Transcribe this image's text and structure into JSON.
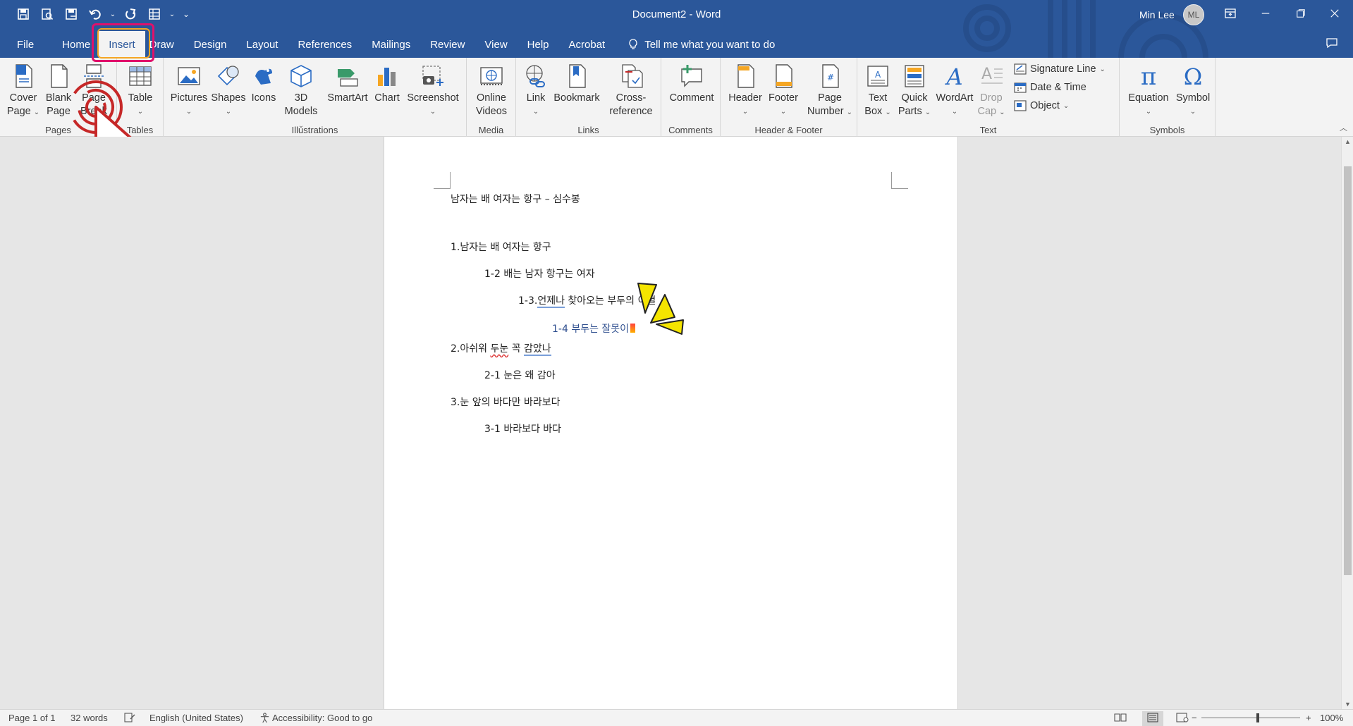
{
  "window": {
    "title": "Document2  -  Word",
    "user_name": "Min Lee",
    "user_initials": "ML"
  },
  "quick_access": [
    "save-icon",
    "print-preview-icon",
    "save-as-icon",
    "undo-icon",
    "redo-icon",
    "table-icon",
    "customize-icon"
  ],
  "tabs": [
    {
      "label": "File"
    },
    {
      "label": "Home"
    },
    {
      "label": "Insert",
      "active": true
    },
    {
      "label": "Draw"
    },
    {
      "label": "Design"
    },
    {
      "label": "Layout"
    },
    {
      "label": "References"
    },
    {
      "label": "Mailings"
    },
    {
      "label": "Review"
    },
    {
      "label": "View"
    },
    {
      "label": "Help"
    },
    {
      "label": "Acrobat"
    }
  ],
  "tell_me": "Tell me what you want to do",
  "ribbon": {
    "pages": {
      "label": "Pages",
      "cover_page": "Cover",
      "cover_page2": "Page",
      "blank_page": "Blank",
      "blank_page2": "Page",
      "page_break": "Page",
      "page_break2": "Break"
    },
    "tables": {
      "label": "Tables",
      "table": "Table"
    },
    "illustrations": {
      "label": "Illustrations",
      "pictures": "Pictures",
      "shapes": "Shapes",
      "icons": "Icons",
      "models": "3D",
      "models2": "Models",
      "smartart": "SmartArt",
      "chart": "Chart",
      "screenshot": "Screenshot"
    },
    "media": {
      "label": "Media",
      "online_videos": "Online",
      "online_videos2": "Videos"
    },
    "links": {
      "label": "Links",
      "link": "Link",
      "bookmark": "Bookmark",
      "cross_reference": "Cross-",
      "cross_reference2": "reference"
    },
    "comments": {
      "label": "Comments",
      "comment": "Comment"
    },
    "header_footer": {
      "label": "Header & Footer",
      "header": "Header",
      "footer": "Footer",
      "page_number": "Page",
      "page_number2": "Number"
    },
    "text": {
      "label": "Text",
      "text_box": "Text",
      "text_box2": "Box",
      "quick_parts": "Quick",
      "quick_parts2": "Parts",
      "wordart": "WordArt",
      "drop_cap": "Drop",
      "drop_cap2": "Cap",
      "signature_line": "Signature Line",
      "date_time": "Date & Time",
      "object": "Object"
    },
    "symbols": {
      "label": "Symbols",
      "equation": "Equation",
      "symbol": "Symbol"
    }
  },
  "document": {
    "lines": [
      "남자는 배 여자는 항구 – 심수봉",
      "1.남자는 배 여자는 항구",
      "1-2 배는 남자 항구는 여자",
      "1-3.",
      "언제나",
      " 찾아오는 부두의 이별",
      "1-4 부두는 잘못이",
      "2.아쉬워 ",
      "두눈",
      " 꼭 ",
      "감았나",
      "2-1 눈은 왜 감아",
      "3.눈 앞의 바다만 바라보다",
      "3-1 바라보다 바다"
    ]
  },
  "statusbar": {
    "page": "Page 1 of 1",
    "words": "32 words",
    "language": "English (United States)",
    "accessibility": "Accessibility: Good to go",
    "zoom_percent": "100%",
    "zoom_level": 1.0
  },
  "colors": {
    "title_bar": "#2b579a",
    "ribbon_bg": "#f3f3f3",
    "highlight_pink": "#e0116b",
    "highlight_orange": "#f5a623",
    "annotation_red": "#c62828",
    "sparkle_yellow": "#f5e500"
  }
}
